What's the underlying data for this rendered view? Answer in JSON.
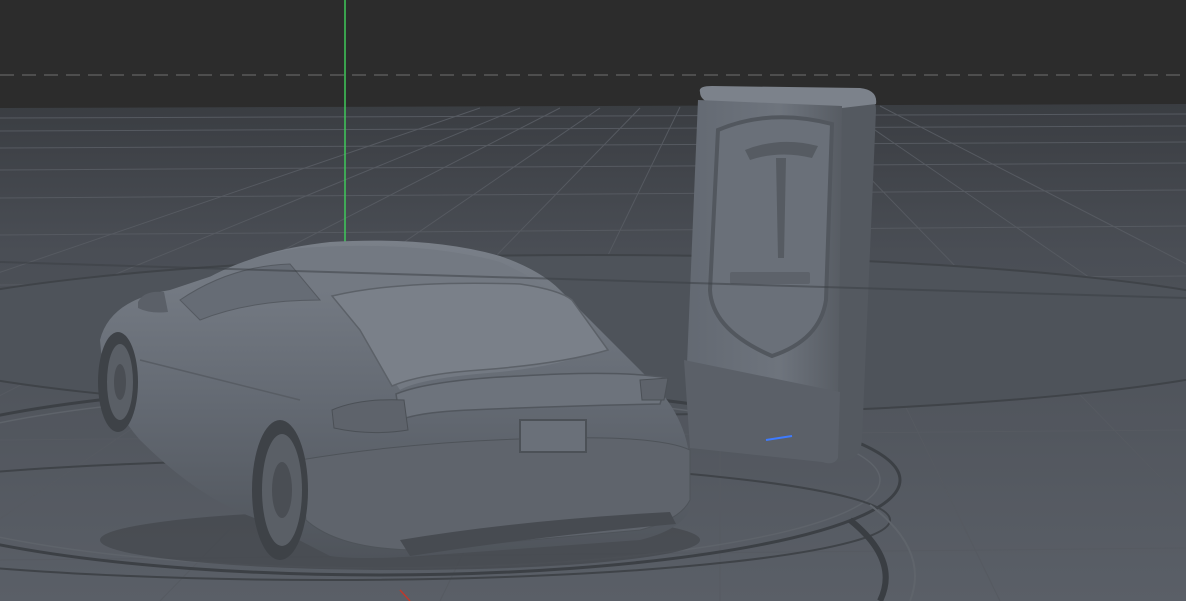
{
  "viewport": {
    "type": "3d-viewport",
    "shading": "solid",
    "background_color": "#2c2c2c",
    "floor_color": "#4d525a",
    "grid_line_color": "#5e636b",
    "horizon_line_color": "#5a5a5a",
    "y_axis_color": "#3ec95a",
    "x_axis_color": "#c0392b",
    "z_axis_color": "#3e7bff",
    "model_color": "#6b717a"
  },
  "scene_objects": [
    {
      "name": "car",
      "label": ""
    },
    {
      "name": "supercharger",
      "label": ""
    },
    {
      "name": "ground-disc",
      "label": ""
    }
  ]
}
